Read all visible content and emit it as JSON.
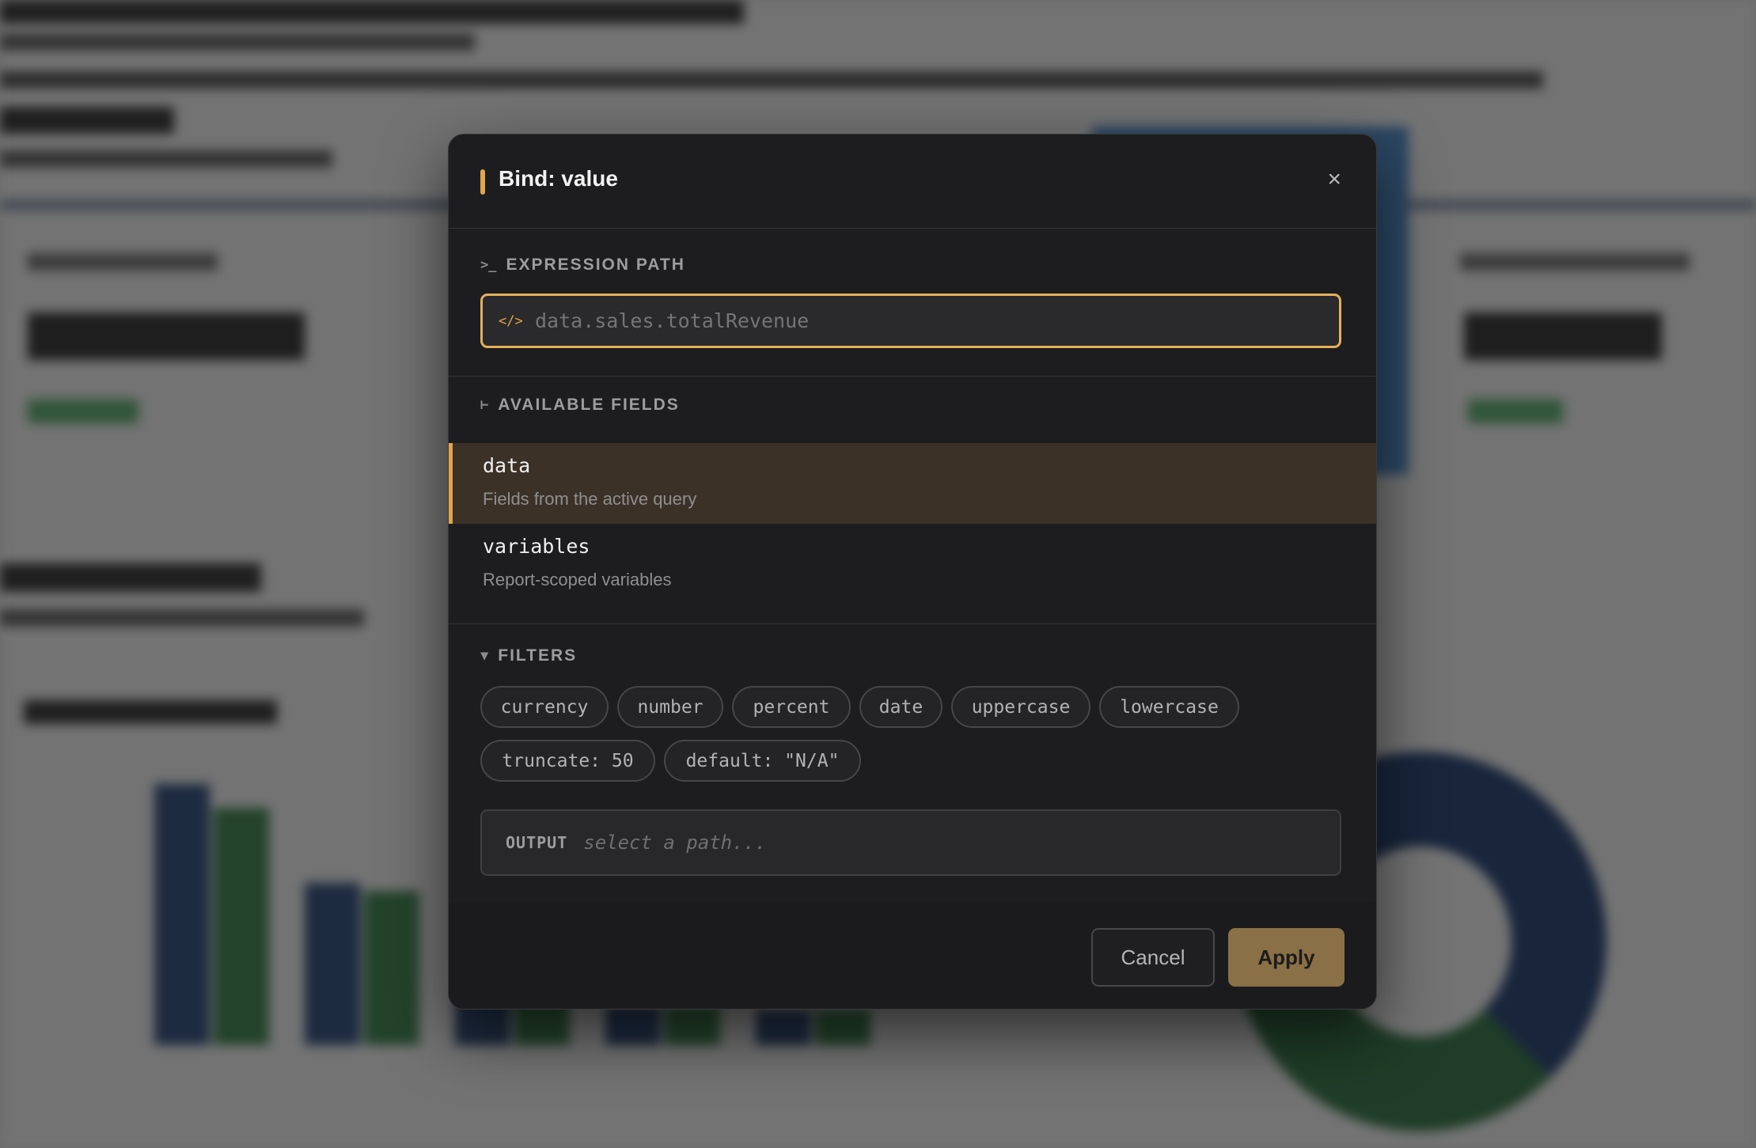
{
  "modal": {
    "title": "Bind: value",
    "close_glyph": "×"
  },
  "expression": {
    "label": "EXPRESSION PATH",
    "icon": "terminal-icon",
    "input_icon": "code-icon",
    "value": "data.sales.totalRevenue"
  },
  "fields": {
    "label": "AVAILABLE FIELDS",
    "icon": "tree-icon",
    "items": [
      {
        "name": "data",
        "description": "Fields from the active query",
        "active": true
      },
      {
        "name": "variables",
        "description": "Report-scoped variables",
        "active": false
      }
    ]
  },
  "filters": {
    "label": "FILTERS",
    "icon": "filter-icon",
    "chips": [
      "currency",
      "number",
      "percent",
      "date",
      "uppercase",
      "lowercase",
      "truncate: 50",
      "default: \"N/A\""
    ]
  },
  "output": {
    "label": "OUTPUT",
    "placeholder": "select a path..."
  },
  "footer": {
    "cancel_label": "Cancel",
    "apply_label": "Apply"
  },
  "colors": {
    "accent": "#e3a54a",
    "modal_bg": "#1d1d1f",
    "active_row": "#3b3127",
    "apply_bg": "#8a7046"
  }
}
